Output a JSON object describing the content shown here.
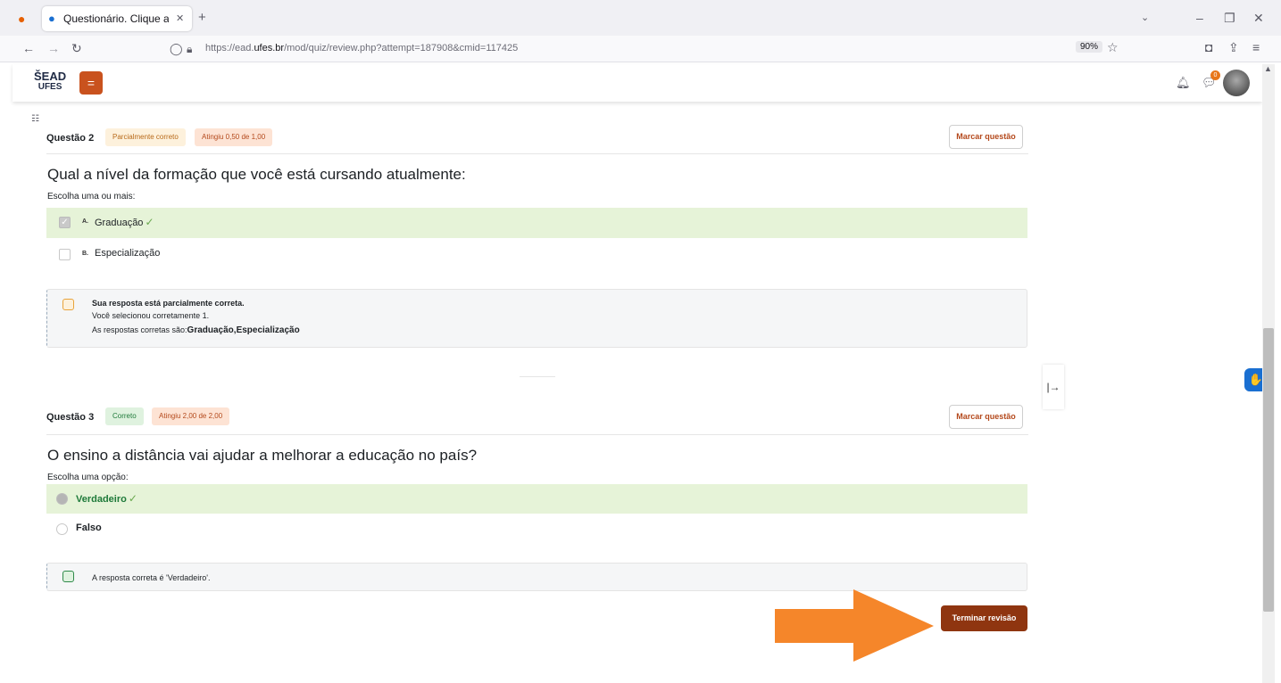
{
  "browser": {
    "tab_title": "Questionário. Clique aqui para",
    "new_tab_label": "+",
    "url_prefix": "https://ead.",
    "url_domain": "ufes.br",
    "url_path": "/mod/quiz/review.php?attempt=187908&cmid=117425",
    "zoom": "90%",
    "window": {
      "minimize": "–",
      "restore": "❐",
      "close": "✕"
    }
  },
  "site": {
    "logo_top": "ŠEAD",
    "logo_bottom": "UFES",
    "menu_button": "=",
    "notification_count": "0"
  },
  "questions": [
    {
      "number_label": "Questão 2",
      "state": "Parcialmente correto",
      "grade": "Atingiu 0,50 de 1,00",
      "flag_button": "Marcar questão",
      "text": "Qual a nível da formação que você está cursando atualmente:",
      "prompt": "Escolha uma ou mais:",
      "answers": [
        {
          "letter": "A.",
          "text": "Graduação",
          "checked": true,
          "correct": true
        },
        {
          "letter": "B.",
          "text": "Especialização",
          "checked": false,
          "correct": false
        }
      ],
      "feedback": {
        "line1": "Sua resposta está parcialmente correta.",
        "line2": "Você selecionou corretamente 1.",
        "line3_prefix": "As respostas corretas são:",
        "line3_value": "Graduação,Especialização"
      }
    },
    {
      "number_label": "Questão 3",
      "state": "Correto",
      "grade": "Atingiu 2,00 de 2,00",
      "flag_button": "Marcar questão",
      "text": "O ensino a distância vai ajudar a melhorar a educação no país?",
      "prompt": "Escolha uma opção:",
      "answers": [
        {
          "text": "Verdadeiro",
          "checked": true,
          "correct": true
        },
        {
          "text": "Falso",
          "checked": false,
          "correct": false
        }
      ],
      "feedback": {
        "line1": "A resposta correta é 'Verdadeiro'."
      }
    }
  ],
  "finish_button": "Terminar revisão",
  "colors": {
    "accent": "#c9521e",
    "finish": "#8f3510",
    "arrow": "#f5862a",
    "correct_bg": "#e6f3d8"
  }
}
